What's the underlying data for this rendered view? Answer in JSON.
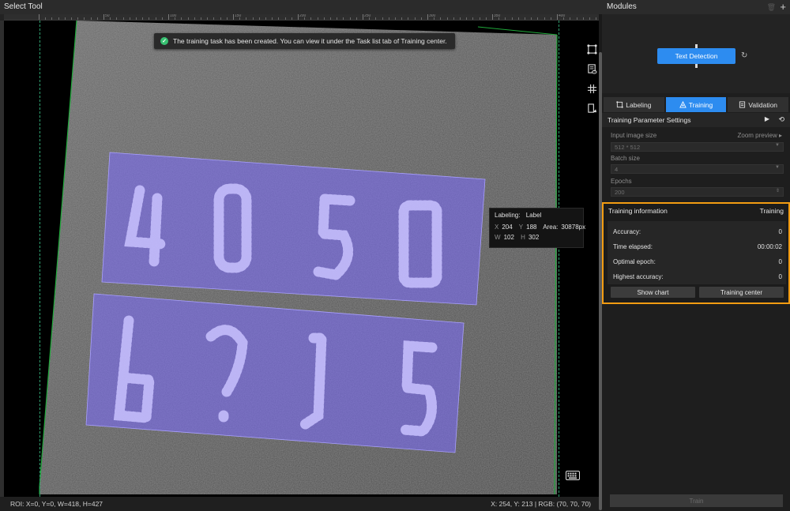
{
  "left_panel": {
    "title": "Select Tool",
    "ruler_labels": [
      "50",
      "100",
      "150",
      "200",
      "250",
      "300",
      "350",
      "400"
    ]
  },
  "toast": {
    "message": "The training task has been created. You can view it under the Task list tab of Training center."
  },
  "label_tooltip": {
    "labeling_key": "Labeling:",
    "labeling_value": "Label",
    "x_key": "X",
    "x_val": "204",
    "y_key": "Y",
    "y_val": "188",
    "area_key": "Area:",
    "area_val": "30878px",
    "w_key": "W",
    "w_val": "102",
    "h_key": "H",
    "h_val": "302"
  },
  "canvas_tools": [
    "polygon-edit-icon",
    "mask-view-icon",
    "grid-icon",
    "brush-eraser-icon"
  ],
  "status": {
    "roi": "ROI: X=0, Y=0, W=418, H=427",
    "coords": "X: 254, Y: 213 | RGB: (70, 70, 70)"
  },
  "modules": {
    "title": "Modules",
    "node_label": "Text Detection"
  },
  "tabs": [
    {
      "label": "Labeling",
      "icon": "labeling-icon",
      "active": false
    },
    {
      "label": "Training",
      "icon": "training-icon",
      "active": true
    },
    {
      "label": "Validation",
      "icon": "validation-icon",
      "active": false
    }
  ],
  "params": {
    "title": "Training Parameter Settings",
    "input_size_label": "Input image size",
    "zoom_preview": "Zoom preview",
    "input_size_value": "512 * 512",
    "batch_label": "Batch size",
    "batch_value": "4",
    "epochs_label": "Epochs",
    "epochs_value": "200"
  },
  "training_info": {
    "title": "Training information",
    "state": "Training",
    "rows": [
      {
        "label": "Accuracy:",
        "value": "0"
      },
      {
        "label": "Time elapsed:",
        "value": "00:00:02"
      },
      {
        "label": "Optimal epoch:",
        "value": "0"
      },
      {
        "label": "Highest accuracy:",
        "value": "0"
      }
    ],
    "show_chart": "Show chart",
    "training_center": "Training center"
  },
  "train_button": "Train",
  "colors": {
    "accent": "#2d8cf0",
    "highlight_border": "#f39c12",
    "label_fill": "#7b6cff",
    "success": "#38c172"
  }
}
